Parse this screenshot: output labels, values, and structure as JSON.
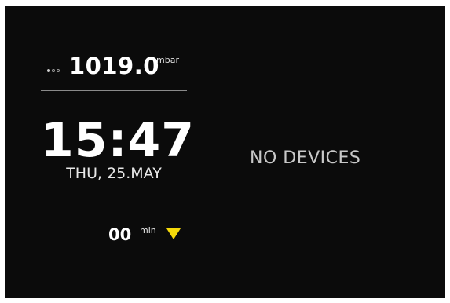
{
  "pressure": {
    "indicator_dots": [
      "filled",
      "empty",
      "empty"
    ],
    "value": "1019.0",
    "unit": "mbar"
  },
  "clock": {
    "time": "15:47",
    "date": "THU, 25.MAY"
  },
  "timer": {
    "value": "00",
    "unit": "min",
    "dropdown_icon": "triangle-down-icon",
    "dropdown_color": "#f5d90a"
  },
  "devices": {
    "status": "NO DEVICES"
  },
  "colors": {
    "background": "#0b0b0b",
    "text": "#ffffff",
    "accent": "#f5d90a"
  }
}
